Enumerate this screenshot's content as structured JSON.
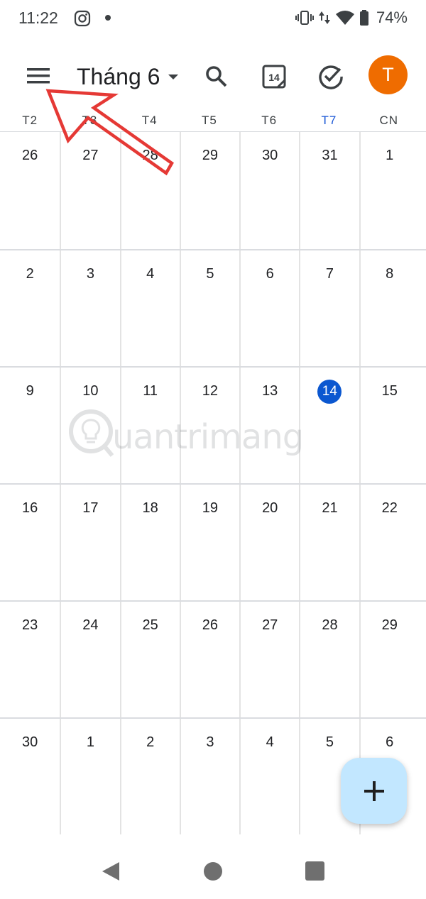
{
  "status_bar": {
    "time": "11:22",
    "battery": "74%",
    "icons": [
      "instagram-icon",
      "notification-dot",
      "vibrate-icon",
      "data-arrows-icon",
      "wifi-icon",
      "battery-icon"
    ]
  },
  "app_bar": {
    "month": "Tháng 6",
    "today_icon_number": "14",
    "avatar_initial": "T",
    "avatar_color": "#ef6c00",
    "icons": [
      "menu-icon",
      "dropdown-caret-icon",
      "search-icon",
      "today-calendar-icon",
      "tasks-check-icon"
    ]
  },
  "weekdays": [
    "T2",
    "T3",
    "T4",
    "T5",
    "T6",
    "T7",
    "CN"
  ],
  "current_weekday_index": 5,
  "weeks": [
    [
      "26",
      "27",
      "28",
      "29",
      "30",
      "31",
      "1"
    ],
    [
      "2",
      "3",
      "4",
      "5",
      "6",
      "7",
      "8"
    ],
    [
      "9",
      "10",
      "11",
      "12",
      "13",
      "14",
      "15"
    ],
    [
      "16",
      "17",
      "18",
      "19",
      "20",
      "21",
      "22"
    ],
    [
      "23",
      "24",
      "25",
      "26",
      "27",
      "28",
      "29"
    ],
    [
      "30",
      "1",
      "2",
      "3",
      "4",
      "5",
      "6"
    ]
  ],
  "today": {
    "week": 2,
    "day": 5,
    "label": "14"
  },
  "watermark": "uantrimang",
  "fab": {
    "icon": "plus-icon",
    "color": "#c2e7ff"
  },
  "nav_bar": {
    "icons": [
      "back-icon",
      "home-icon",
      "recents-icon"
    ]
  },
  "colors": {
    "accent": "#0b57d0",
    "current_weekday": "#1a57d6",
    "annotation_arrow": "#e53935",
    "grid_line": "#dadce0"
  }
}
